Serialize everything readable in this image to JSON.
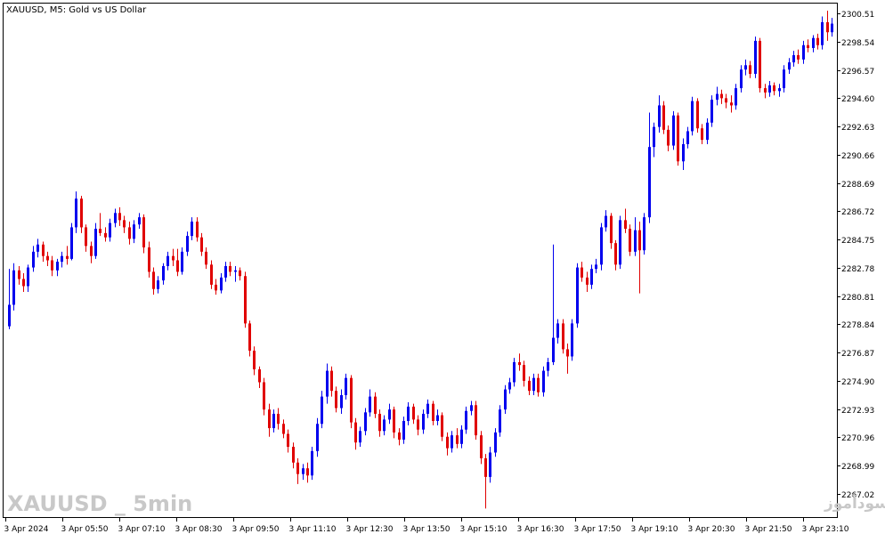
{
  "header": {
    "title": "XAUUSD, M5:  Gold vs US Dollar"
  },
  "watermark": {
    "left": "XAUUSD _ 5min",
    "right": "انتشار در سایت سودآموز"
  },
  "colors": {
    "bull": "#0000ee",
    "bear": "#e00000",
    "neutral": "#000000",
    "axis": "#000000",
    "watermark": "#c8c8c8",
    "background": "#ffffff"
  },
  "chart_data": {
    "type": "candlestick",
    "title": "XAUUSD, M5:  Gold vs US Dollar",
    "ylim": [
      2265.4,
      2301.2
    ],
    "y_ticks": [
      "2300.51",
      "2298.54",
      "2296.57",
      "2294.60",
      "2292.63",
      "2290.66",
      "2288.69",
      "2286.72",
      "2284.75",
      "2282.78",
      "2280.81",
      "2278.84",
      "2276.87",
      "2274.90",
      "2272.93",
      "2270.96",
      "2268.99",
      "2267.02"
    ],
    "x_ticks": [
      "3 Apr 2024",
      "3 Apr 05:50",
      "3 Apr 07:10",
      "3 Apr 08:30",
      "3 Apr 09:50",
      "3 Apr 11:10",
      "3 Apr 12:30",
      "3 Apr 13:50",
      "3 Apr 15:10",
      "3 Apr 16:30",
      "3 Apr 17:50",
      "3 Apr 19:10",
      "3 Apr 20:30",
      "3 Apr 21:50",
      "3 Apr 23:10"
    ],
    "candles": [
      [
        2278.7,
        2282.7,
        2278.5,
        2280.2
      ],
      [
        2280.2,
        2283.1,
        2279.8,
        2282.6
      ],
      [
        2282.6,
        2282.9,
        2281.6,
        2282.0
      ],
      [
        2282.0,
        2282.4,
        2281.1,
        2281.5
      ],
      [
        2281.5,
        2283.0,
        2281.1,
        2282.8
      ],
      [
        2282.8,
        2284.3,
        2282.5,
        2283.9
      ],
      [
        2283.9,
        2284.8,
        2283.5,
        2284.4
      ],
      [
        2284.4,
        2284.6,
        2283.2,
        2283.6
      ],
      [
        2283.6,
        2283.9,
        2282.9,
        2283.3
      ],
      [
        2283.3,
        2283.6,
        2282.2,
        2282.6
      ],
      [
        2282.6,
        2283.4,
        2282.2,
        2283.2
      ],
      [
        2283.2,
        2283.9,
        2282.8,
        2283.6
      ],
      [
        2283.6,
        2284.3,
        2283.0,
        2283.4
      ],
      [
        2283.4,
        2285.9,
        2283.3,
        2285.6
      ],
      [
        2285.6,
        2288.1,
        2285.2,
        2287.6
      ],
      [
        2287.6,
        2287.8,
        2285.2,
        2285.6
      ],
      [
        2285.6,
        2285.8,
        2283.9,
        2284.3
      ],
      [
        2284.3,
        2284.6,
        2283.1,
        2283.6
      ],
      [
        2283.6,
        2285.9,
        2283.4,
        2285.5
      ],
      [
        2285.5,
        2286.6,
        2285.0,
        2285.2
      ],
      [
        2285.2,
        2285.6,
        2284.6,
        2284.9
      ],
      [
        2284.9,
        2286.2,
        2284.6,
        2285.9
      ],
      [
        2285.9,
        2286.9,
        2285.6,
        2286.6
      ],
      [
        2286.6,
        2287.0,
        2285.7,
        2286.1
      ],
      [
        2286.1,
        2286.4,
        2285.2,
        2285.6
      ],
      [
        2285.6,
        2286.0,
        2284.4,
        2284.8
      ],
      [
        2284.8,
        2286.1,
        2284.5,
        2285.8
      ],
      [
        2285.8,
        2286.6,
        2285.5,
        2286.3
      ],
      [
        2286.3,
        2286.5,
        2283.8,
        2284.2
      ],
      [
        2284.2,
        2284.6,
        2282.1,
        2282.5
      ],
      [
        2282.5,
        2282.8,
        2280.9,
        2281.3
      ],
      [
        2281.3,
        2282.2,
        2281.0,
        2281.9
      ],
      [
        2281.9,
        2283.1,
        2281.6,
        2282.9
      ],
      [
        2282.9,
        2283.9,
        2282.6,
        2283.6
      ],
      [
        2283.6,
        2284.1,
        2282.9,
        2283.3
      ],
      [
        2283.3,
        2284.1,
        2282.2,
        2282.5
      ],
      [
        2282.5,
        2284.2,
        2282.3,
        2283.9
      ],
      [
        2283.9,
        2285.3,
        2283.6,
        2285.0
      ],
      [
        2285.0,
        2286.3,
        2284.7,
        2286.0
      ],
      [
        2286.0,
        2286.3,
        2284.6,
        2284.9
      ],
      [
        2284.9,
        2285.2,
        2283.6,
        2283.9
      ],
      [
        2283.9,
        2284.2,
        2282.7,
        2283.0
      ],
      [
        2283.0,
        2283.3,
        2281.3,
        2281.6
      ],
      [
        2281.6,
        2282.0,
        2280.9,
        2281.2
      ],
      [
        2281.2,
        2282.4,
        2281.0,
        2282.1
      ],
      [
        2282.1,
        2283.2,
        2281.8,
        2282.9
      ],
      [
        2282.9,
        2283.2,
        2282.2,
        2282.5
      ],
      [
        2282.5,
        2282.9,
        2281.8,
        2282.6
      ],
      [
        2282.6,
        2282.8,
        2281.9,
        2282.2
      ],
      [
        2282.2,
        2282.5,
        2278.6,
        2278.9
      ],
      [
        2278.9,
        2279.1,
        2276.6,
        2277.0
      ],
      [
        2277.0,
        2277.3,
        2275.3,
        2275.7
      ],
      [
        2275.7,
        2275.9,
        2274.4,
        2274.8
      ],
      [
        2274.8,
        2275.1,
        2272.5,
        2272.9
      ],
      [
        2272.9,
        2273.3,
        2271.0,
        2271.6
      ],
      [
        2271.6,
        2272.9,
        2271.3,
        2272.6
      ],
      [
        2272.6,
        2273.0,
        2271.5,
        2271.9
      ],
      [
        2271.9,
        2272.2,
        2270.9,
        2271.2
      ],
      [
        2271.2,
        2271.5,
        2269.9,
        2270.3
      ],
      [
        2270.3,
        2270.6,
        2268.8,
        2269.2
      ],
      [
        2269.2,
        2269.5,
        2267.7,
        2268.4
      ],
      [
        2268.4,
        2269.1,
        2268.0,
        2268.8
      ],
      [
        2268.8,
        2269.2,
        2267.8,
        2268.3
      ],
      [
        2268.3,
        2270.3,
        2268.0,
        2270.0
      ],
      [
        2270.0,
        2272.3,
        2269.6,
        2271.9
      ],
      [
        2271.9,
        2274.2,
        2271.6,
        2273.8
      ],
      [
        2273.8,
        2276.1,
        2273.3,
        2275.6
      ],
      [
        2275.6,
        2275.9,
        2273.8,
        2274.2
      ],
      [
        2274.2,
        2274.5,
        2272.7,
        2273.0
      ],
      [
        2273.0,
        2274.3,
        2272.6,
        2273.9
      ],
      [
        2273.9,
        2275.4,
        2273.6,
        2275.1
      ],
      [
        2275.1,
        2275.3,
        2271.6,
        2272.0
      ],
      [
        2272.0,
        2272.3,
        2270.1,
        2270.6
      ],
      [
        2270.6,
        2271.7,
        2270.3,
        2271.4
      ],
      [
        2271.4,
        2273.0,
        2271.1,
        2272.7
      ],
      [
        2272.7,
        2274.3,
        2272.4,
        2273.8
      ],
      [
        2273.8,
        2274.1,
        2272.3,
        2272.6
      ],
      [
        2272.6,
        2272.9,
        2271.0,
        2271.4
      ],
      [
        2271.4,
        2272.5,
        2271.1,
        2272.2
      ],
      [
        2272.2,
        2273.3,
        2271.9,
        2272.9
      ],
      [
        2272.9,
        2273.1,
        2270.9,
        2271.3
      ],
      [
        2271.3,
        2271.6,
        2270.4,
        2270.8
      ],
      [
        2270.8,
        2272.4,
        2270.5,
        2272.1
      ],
      [
        2272.1,
        2273.4,
        2271.8,
        2273.1
      ],
      [
        2273.1,
        2273.3,
        2271.9,
        2272.2
      ],
      [
        2272.2,
        2272.5,
        2271.1,
        2271.5
      ],
      [
        2271.5,
        2272.9,
        2271.2,
        2272.6
      ],
      [
        2272.6,
        2273.6,
        2272.3,
        2273.3
      ],
      [
        2273.3,
        2273.5,
        2271.8,
        2272.1
      ],
      [
        2272.1,
        2272.9,
        2271.8,
        2272.5
      ],
      [
        2272.5,
        2272.7,
        2270.7,
        2271.0
      ],
      [
        2271.0,
        2271.3,
        2269.7,
        2270.2
      ],
      [
        2270.2,
        2271.4,
        2269.9,
        2271.1
      ],
      [
        2271.1,
        2271.6,
        2270.2,
        2270.5
      ],
      [
        2270.5,
        2271.8,
        2270.2,
        2271.5
      ],
      [
        2271.5,
        2273.1,
        2271.2,
        2272.8
      ],
      [
        2272.8,
        2273.5,
        2272.5,
        2273.2
      ],
      [
        2273.2,
        2273.5,
        2270.8,
        2271.1
      ],
      [
        2271.1,
        2271.4,
        2269.1,
        2269.5
      ],
      [
        2269.5,
        2269.8,
        2266.0,
        2268.2
      ],
      [
        2268.2,
        2270.3,
        2267.8,
        2269.9
      ],
      [
        2269.9,
        2271.6,
        2269.6,
        2271.3
      ],
      [
        2271.3,
        2273.2,
        2271.0,
        2272.9
      ],
      [
        2272.9,
        2274.6,
        2272.6,
        2274.3
      ],
      [
        2274.3,
        2275.1,
        2274.0,
        2274.8
      ],
      [
        2274.8,
        2276.5,
        2274.5,
        2276.2
      ],
      [
        2276.2,
        2276.8,
        2275.6,
        2276.0
      ],
      [
        2276.0,
        2276.3,
        2274.5,
        2274.9
      ],
      [
        2274.9,
        2275.2,
        2273.9,
        2274.2
      ],
      [
        2274.2,
        2275.4,
        2273.9,
        2275.1
      ],
      [
        2275.1,
        2275.4,
        2273.8,
        2274.1
      ],
      [
        2274.1,
        2275.9,
        2273.8,
        2275.6
      ],
      [
        2275.6,
        2276.5,
        2275.2,
        2276.2
      ],
      [
        2276.2,
        2284.4,
        2276.0,
        2277.9
      ],
      [
        2277.9,
        2279.2,
        2277.5,
        2278.9
      ],
      [
        2278.9,
        2279.2,
        2276.8,
        2277.1
      ],
      [
        2277.1,
        2277.5,
        2275.4,
        2276.6
      ],
      [
        2276.6,
        2279.2,
        2276.3,
        2278.9
      ],
      [
        2278.9,
        2283.1,
        2278.6,
        2282.8
      ],
      [
        2282.8,
        2283.2,
        2281.8,
        2282.1
      ],
      [
        2282.1,
        2282.5,
        2281.1,
        2281.6
      ],
      [
        2281.6,
        2283.0,
        2281.3,
        2282.7
      ],
      [
        2282.7,
        2283.4,
        2282.4,
        2283.0
      ],
      [
        2283.0,
        2285.9,
        2282.6,
        2285.6
      ],
      [
        2285.6,
        2286.8,
        2285.3,
        2286.4
      ],
      [
        2286.4,
        2286.6,
        2284.1,
        2284.5
      ],
      [
        2284.5,
        2284.7,
        2282.6,
        2283.0
      ],
      [
        2283.0,
        2286.4,
        2282.7,
        2286.1
      ],
      [
        2286.1,
        2286.9,
        2285.2,
        2285.5
      ],
      [
        2285.5,
        2285.8,
        2283.6,
        2283.9
      ],
      [
        2283.9,
        2286.3,
        2283.6,
        2285.4
      ],
      [
        2285.4,
        2286.0,
        2281.0,
        2284.0
      ],
      [
        2284.0,
        2286.6,
        2283.7,
        2286.3
      ],
      [
        2286.3,
        2293.6,
        2285.9,
        2291.2
      ],
      [
        2291.2,
        2292.9,
        2290.5,
        2292.6
      ],
      [
        2292.6,
        2294.8,
        2292.2,
        2294.1
      ],
      [
        2294.1,
        2294.4,
        2292.1,
        2292.4
      ],
      [
        2292.4,
        2292.7,
        2290.9,
        2291.3
      ],
      [
        2291.3,
        2293.7,
        2291.0,
        2293.4
      ],
      [
        2293.4,
        2293.6,
        2289.9,
        2290.2
      ],
      [
        2290.2,
        2291.8,
        2289.6,
        2291.4
      ],
      [
        2291.4,
        2292.6,
        2291.1,
        2292.3
      ],
      [
        2292.3,
        2294.7,
        2292.0,
        2294.4
      ],
      [
        2294.4,
        2294.6,
        2292.2,
        2292.5
      ],
      [
        2292.5,
        2292.8,
        2291.4,
        2291.7
      ],
      [
        2291.7,
        2293.2,
        2291.4,
        2292.9
      ],
      [
        2292.9,
        2294.8,
        2292.6,
        2294.5
      ],
      [
        2294.5,
        2295.4,
        2294.1,
        2294.9
      ],
      [
        2294.9,
        2295.2,
        2294.2,
        2294.6
      ],
      [
        2294.6,
        2294.9,
        2293.9,
        2294.3
      ],
      [
        2294.3,
        2294.8,
        2293.6,
        2294.1
      ],
      [
        2294.1,
        2295.6,
        2293.8,
        2295.3
      ],
      [
        2295.3,
        2296.9,
        2295.0,
        2296.6
      ],
      [
        2296.6,
        2297.3,
        2296.2,
        2296.9
      ],
      [
        2296.9,
        2297.2,
        2296.0,
        2296.3
      ],
      [
        2296.3,
        2298.9,
        2296.0,
        2298.6
      ],
      [
        2298.6,
        2298.8,
        2295.0,
        2295.3
      ],
      [
        2295.3,
        2295.6,
        2294.6,
        2295.0
      ],
      [
        2295.0,
        2295.8,
        2294.7,
        2295.5
      ],
      [
        2295.5,
        2295.7,
        2294.8,
        2295.1
      ],
      [
        2295.1,
        2295.6,
        2294.7,
        2295.3
      ],
      [
        2295.3,
        2296.9,
        2295.0,
        2296.6
      ],
      [
        2296.6,
        2297.4,
        2296.3,
        2297.1
      ],
      [
        2297.1,
        2297.9,
        2296.8,
        2297.6
      ],
      [
        2297.6,
        2298.0,
        2297.0,
        2297.3
      ],
      [
        2297.3,
        2298.6,
        2297.0,
        2298.3
      ],
      [
        2298.3,
        2298.7,
        2297.8,
        2298.1
      ],
      [
        2298.1,
        2299.0,
        2297.8,
        2298.8
      ],
      [
        2298.8,
        2299.1,
        2298.0,
        2298.3
      ],
      [
        2298.3,
        2300.3,
        2298.0,
        2299.9
      ],
      [
        2299.9,
        2300.7,
        2298.6,
        2299.2
      ],
      [
        2299.2,
        2300.2,
        2298.9,
        2299.8
      ]
    ]
  }
}
